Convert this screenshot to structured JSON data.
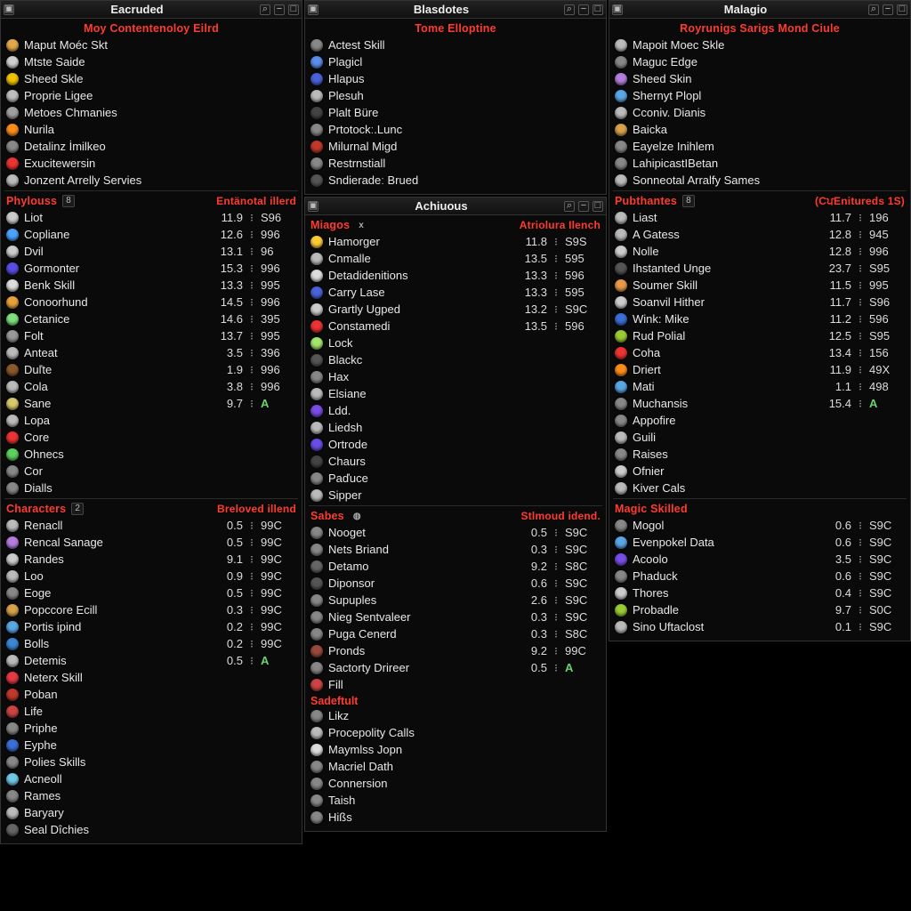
{
  "col1": {
    "panel1": {
      "title": "Eacruded",
      "header": "Moy Contentenoloy Eilrd",
      "items": [
        {
          "icon": "#e2a94a",
          "label": "Maput Moéc Skt"
        },
        {
          "icon": "#d0d0d0",
          "label": "Mtste Saide"
        },
        {
          "icon": "#f2c200",
          "label": "Sheed Skle"
        },
        {
          "icon": "#bdbdbd",
          "label": "Proprie Ligee"
        },
        {
          "icon": "#a0a0a0",
          "label": "Metoes Chmanies"
        },
        {
          "icon": "#ff8c1a",
          "label": "Nurila"
        },
        {
          "icon": "#888",
          "label": "Detalinz İmilkeo"
        },
        {
          "icon": "#e33",
          "label": "Exucitewersin"
        },
        {
          "icon": "#bbb",
          "label": "Jonzent Arrelly Servies"
        }
      ]
    },
    "panel2": {
      "left": "Phylouss",
      "leftCount": "8",
      "right": "Entänotal illerd",
      "rows": [
        {
          "icon": "#ccc",
          "label": "Liot",
          "v1": "11.9",
          "v2": "S96"
        },
        {
          "icon": "#4aa3ff",
          "label": "Copliane",
          "v1": "12.6",
          "v2": "996"
        },
        {
          "icon": "#ccc",
          "label": "Dvil",
          "v1": "13.1",
          "v2": "96"
        },
        {
          "icon": "#5a4de6",
          "label": "Gormonter",
          "v1": "15.3",
          "v2": "996"
        },
        {
          "icon": "#ddd",
          "label": "Benk Skill",
          "v1": "13.3",
          "v2": "995"
        },
        {
          "icon": "#e8a23a",
          "label": "Conoorhund",
          "v1": "14.5",
          "v2": "996"
        },
        {
          "icon": "#7fe07f",
          "label": "Cetanice",
          "v1": "14.6",
          "v2": "395"
        },
        {
          "icon": "#999",
          "label": "Folt",
          "v1": "13.7",
          "v2": "995"
        },
        {
          "icon": "#bbb",
          "label": "Anteat",
          "v1": "3.5",
          "v2": "396"
        },
        {
          "icon": "#8b5a2b",
          "label": "Duľte",
          "v1": "1.9",
          "v2": "996"
        },
        {
          "icon": "#bbb",
          "label": "Cola",
          "v1": "3.8",
          "v2": "996"
        },
        {
          "icon": "#d8c96a",
          "label": "Sane",
          "v1": "9.7",
          "v2": "A",
          "a": true
        },
        {
          "icon": "#bbb",
          "label": "Lopa"
        },
        {
          "icon": "#e33",
          "label": "Core"
        },
        {
          "icon": "#5dd05d",
          "label": "Ohnecs"
        },
        {
          "icon": "#888",
          "label": "Cor"
        },
        {
          "icon": "#888",
          "label": "Dialls"
        }
      ]
    },
    "panel3": {
      "left": "Characters",
      "leftCount": "2",
      "right": "Breloved illend",
      "rows": [
        {
          "icon": "#bbb",
          "label": "Renacll",
          "v1": "0.5",
          "v2": "99C"
        },
        {
          "icon": "#b57edc",
          "label": "Rencal Sanage",
          "v1": "0.5",
          "v2": "99C"
        },
        {
          "icon": "#ccc",
          "label": "Randes",
          "v1": "9.1",
          "v2": "99C"
        },
        {
          "icon": "#bbb",
          "label": "Loo",
          "v1": "0.9",
          "v2": "99C"
        },
        {
          "icon": "#888",
          "label": "Eoge",
          "v1": "0.5",
          "v2": "99C"
        },
        {
          "icon": "#d6a24a",
          "label": "Popccore Ecill",
          "v1": "0.3",
          "v2": "99C"
        },
        {
          "icon": "#5aa7e6",
          "label": "Portis ipind",
          "v1": "0.2",
          "v2": "99C"
        },
        {
          "icon": "#3a87d6",
          "label": "Bolls",
          "v1": "0.2",
          "v2": "99C"
        },
        {
          "icon": "#bbb",
          "label": "Detemis",
          "v1": "0.5",
          "v2": "A",
          "a": true
        },
        {
          "icon": "#e63946",
          "label": "Neterx Skill"
        },
        {
          "icon": "#c0392b",
          "label": "Poban"
        },
        {
          "icon": "#c44",
          "label": "Life"
        },
        {
          "icon": "#888",
          "label": "Priphe"
        },
        {
          "icon": "#3a6fd6",
          "label": "Eyphe"
        },
        {
          "icon": "#888",
          "label": "Polies Skills"
        },
        {
          "icon": "#6fc8e6",
          "label": "Acneoll"
        },
        {
          "icon": "#888",
          "label": "Rames"
        },
        {
          "icon": "#bbb",
          "label": "Baryary"
        },
        {
          "icon": "#666",
          "label": "Seal Dîchies"
        }
      ]
    }
  },
  "col2": {
    "panel1": {
      "title": "Blasdotes",
      "header": "Tome Elloptine",
      "items": [
        {
          "icon": "#888",
          "label": "Actest Skill"
        },
        {
          "icon": "#5a8de6",
          "label": "Plagicl"
        },
        {
          "icon": "#4a62d6",
          "label": "Hlapus"
        },
        {
          "icon": "#bbb",
          "label": "Plesuh"
        },
        {
          "icon": "#444",
          "label": "Plalt Büre"
        },
        {
          "icon": "#888",
          "label": "Prtotockː.Lunc"
        },
        {
          "icon": "#c0392b",
          "label": "Milurnal Migd"
        },
        {
          "icon": "#888",
          "label": "Restrnstiall"
        },
        {
          "icon": "#555",
          "label": "Sndieradeː Brued"
        }
      ]
    },
    "panel2": {
      "title": "Achiuous",
      "left": "Miagos",
      "leftBadge": "x",
      "right": "Atriolura Ilench",
      "rows": [
        {
          "icon": "#ffcc33",
          "label": "Hamorger",
          "v1": "11.8",
          "v2": "S9S"
        },
        {
          "icon": "#bbb",
          "label": "Cnmalle",
          "v1": "13.5",
          "v2": "595"
        },
        {
          "icon": "#ddd",
          "label": "Detadidenitions",
          "v1": "13.3",
          "v2": "596"
        },
        {
          "icon": "#4a62d6",
          "label": "Carry Lase",
          "v1": "13.3",
          "v2": "595"
        },
        {
          "icon": "#ccc",
          "label": "Grartly Ugped",
          "v1": "13.2",
          "v2": "S9C"
        },
        {
          "icon": "#e33",
          "label": "Constamedi",
          "v1": "13.5",
          "v2": "596"
        },
        {
          "icon": "#a3e66b",
          "label": "Lock"
        },
        {
          "icon": "#555",
          "label": "Blackc"
        },
        {
          "icon": "#888",
          "label": "Hax"
        },
        {
          "icon": "#bbb",
          "label": "Elsiane"
        },
        {
          "icon": "#7a4de6",
          "label": "Ldd."
        },
        {
          "icon": "#bbb",
          "label": "Liedsh"
        },
        {
          "icon": "#6a4de6",
          "label": "Ortrode"
        },
        {
          "icon": "#444",
          "label": "Chaurs"
        },
        {
          "icon": "#888",
          "label": "Paďuce"
        },
        {
          "icon": "#bbb",
          "label": "Sipper"
        }
      ]
    },
    "panel3": {
      "left": "Sabes",
      "right": "Stlmoud idend.",
      "rows": [
        {
          "icon": "#888",
          "label": "Nooget",
          "v1": "0.5",
          "v2": "S9C"
        },
        {
          "icon": "#888",
          "label": "Nets Briand",
          "v1": "0.3",
          "v2": "S9C"
        },
        {
          "icon": "#666",
          "label": "Detamo",
          "v1": "9.2",
          "v2": "S8C"
        },
        {
          "icon": "#555",
          "label": "Diponsor",
          "v1": "0.6",
          "v2": "S9C"
        },
        {
          "icon": "#888",
          "label": "Supuples",
          "v1": "2.6",
          "v2": "S9C"
        },
        {
          "icon": "#888",
          "label": "Nieg Sentvaleer",
          "v1": "0.3",
          "v2": "S9C"
        },
        {
          "icon": "#888",
          "label": "Puga Cenerd",
          "v1": "0.3",
          "v2": "S8C"
        },
        {
          "icon": "#9a4a3a",
          "label": "Pronds",
          "v1": "9.2",
          "v2": "99C"
        },
        {
          "icon": "#888",
          "label": "Sactorty Drireer",
          "v1": "0.5",
          "v2": "A",
          "a": true
        },
        {
          "icon": "#c44",
          "label": "Fill"
        }
      ],
      "sub": "Sadeftult",
      "subrows": [
        {
          "icon": "#888",
          "label": "Likz"
        },
        {
          "icon": "#bbb",
          "label": "Procepolity Calls"
        },
        {
          "icon": "#ddd",
          "label": "Maymlss Jopn"
        },
        {
          "icon": "#888",
          "label": "Macriel Dath"
        },
        {
          "icon": "#888",
          "label": "Connersion"
        },
        {
          "icon": "#888",
          "label": "Taish"
        },
        {
          "icon": "#888",
          "label": "Hißs"
        }
      ]
    }
  },
  "col3": {
    "panel1": {
      "title": "Malagio",
      "header": "Royrunigs Sarigs Mond Ciule",
      "items": [
        {
          "icon": "#bbb",
          "label": "Mapoit Moec Skle"
        },
        {
          "icon": "#888",
          "label": "Maguc Edge"
        },
        {
          "icon": "#b57edc",
          "label": "Sheed Skin"
        },
        {
          "icon": "#5aa7e6",
          "label": "Shernyt Plopl"
        },
        {
          "icon": "#bbb",
          "label": "Cconiv. Dianis"
        },
        {
          "icon": "#d6a24a",
          "label": "Baicka"
        },
        {
          "icon": "#888",
          "label": "Eayelze Inihlem"
        },
        {
          "icon": "#888",
          "label": "LahipicastIBetan"
        },
        {
          "icon": "#bbb",
          "label": "Sonneotal Arralfy Sames"
        }
      ]
    },
    "panel2": {
      "left": "Pubthantes",
      "leftCount": "8",
      "right": "(CਪEnitureds 1S)",
      "rows": [
        {
          "icon": "#bbb",
          "label": "Liast",
          "v1": "11.7",
          "v2": "196"
        },
        {
          "icon": "#bbb",
          "label": "A Gatess",
          "v1": "12.8",
          "v2": "945"
        },
        {
          "icon": "#ccc",
          "label": "Nolle",
          "v1": "12.8",
          "v2": "996"
        },
        {
          "icon": "#555",
          "label": "Ihstanted Unge",
          "v1": "23.7",
          "v2": "S95"
        },
        {
          "icon": "#e89a4a",
          "label": "Soumer Skill",
          "v1": "11.5",
          "v2": "995"
        },
        {
          "icon": "#ccc",
          "label": "Soanvil Hither",
          "v1": "11.7",
          "v2": "S96"
        },
        {
          "icon": "#3a6fd6",
          "label": "Wink: Mike",
          "v1": "11.2",
          "v2": "596"
        },
        {
          "icon": "#9acd32",
          "label": "Rud Polial",
          "v1": "12.5",
          "v2": "S95"
        },
        {
          "icon": "#e33",
          "label": "Coha",
          "v1": "13.4",
          "v2": "156"
        },
        {
          "icon": "#ff8c1a",
          "label": "Driert",
          "v1": "11.9",
          "v2": "49X"
        },
        {
          "icon": "#5aa7e6",
          "label": "Mati",
          "v1": "1.1",
          "v2": "498"
        },
        {
          "icon": "#888",
          "label": "Muchansis",
          "v1": "15.4",
          "v2": "A",
          "a": true
        },
        {
          "icon": "#888",
          "label": "Appofire"
        },
        {
          "icon": "#bbb",
          "label": "Guili"
        },
        {
          "icon": "#888",
          "label": "Raises"
        },
        {
          "icon": "#ccc",
          "label": "Ofnier"
        },
        {
          "icon": "#bbb",
          "label": "Kiver Cals"
        }
      ]
    },
    "panel3": {
      "left": "Magic Skilled",
      "rows": [
        {
          "icon": "#888",
          "label": "Mogol",
          "v1": "0.6",
          "v2": "S9C"
        },
        {
          "icon": "#5aa7e6",
          "label": "Evenpokel Data",
          "v1": "0.6",
          "v2": "S9C"
        },
        {
          "icon": "#7a4de6",
          "label": "Acoolo",
          "v1": "3.5",
          "v2": "S9C"
        },
        {
          "icon": "#888",
          "label": "Phaduck",
          "v1": "0.6",
          "v2": "S9C"
        },
        {
          "icon": "#ccc",
          "label": "Thores",
          "v1": "0.4",
          "v2": "S9C"
        },
        {
          "icon": "#9acd32",
          "label": "Probadle",
          "v1": "9.7",
          "v2": "S0C"
        },
        {
          "icon": "#bbb",
          "label": "Sino Uftaclost",
          "v1": "0.1",
          "v2": "S9C"
        }
      ]
    }
  },
  "glyphs": {
    "sep": "፧"
  }
}
